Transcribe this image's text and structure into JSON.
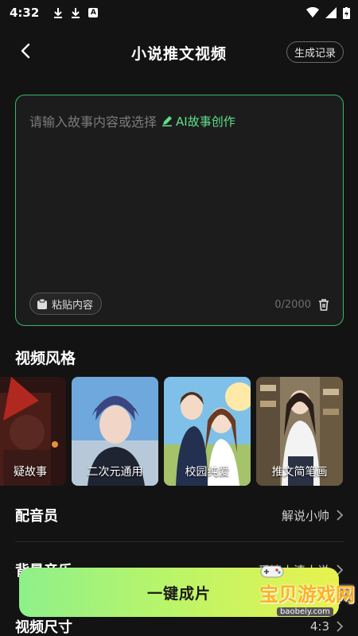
{
  "status_bar": {
    "time": "4:32",
    "a_badge": "A"
  },
  "header": {
    "title": "小说推文视频",
    "history_label": "生成记录"
  },
  "input": {
    "placeholder": "请输入故事内容或选择",
    "ai_link": "AI故事创作",
    "paste_label": "粘贴内容",
    "char_count": "0/2000"
  },
  "style_section": {
    "title": "视频风格",
    "items": [
      {
        "label": "疑故事"
      },
      {
        "label": "二次元通用"
      },
      {
        "label": "校园纯爱"
      },
      {
        "label": "推文简笔画"
      }
    ]
  },
  "settings": [
    {
      "label": "配音员",
      "value": "解说小帅"
    },
    {
      "label": "背景音乐",
      "value": "爱情小清小说"
    },
    {
      "label": "视频尺寸",
      "value": "4:3"
    }
  ],
  "create_button": {
    "label": "一键成片"
  },
  "watermark": {
    "text": "宝贝游戏网",
    "url": "baobeiy.com"
  },
  "colors": {
    "accent_green": "#5fe08c",
    "border_green": "#36b86a",
    "background": "#131313"
  }
}
